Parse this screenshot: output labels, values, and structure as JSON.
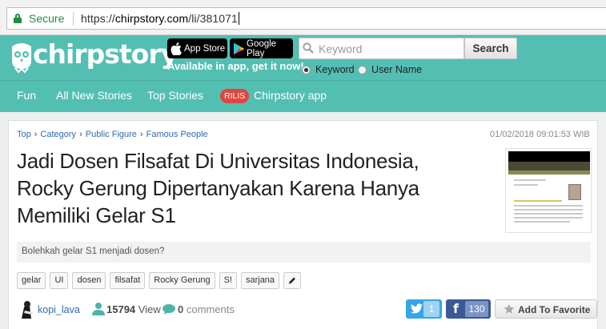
{
  "browser": {
    "secure_label": "Secure",
    "url_scheme": "https://",
    "url_host": "chirpstory.com",
    "url_path": "/li/381071"
  },
  "header": {
    "logo_text": "chirpstory",
    "app_store_label": "App Store",
    "google_play_label": "Google Play",
    "available_text": "Available in app, get it now!",
    "search": {
      "placeholder": "Keyword",
      "button_label": "Search",
      "options": [
        {
          "label": "Keyword",
          "selected": true
        },
        {
          "label": "User Name",
          "selected": false
        }
      ]
    }
  },
  "nav": {
    "items": [
      {
        "label": "Fun"
      },
      {
        "label": "All New Stories"
      },
      {
        "label": "Top Stories"
      }
    ],
    "badge": "RILIS",
    "app_label": "Chirpstory app"
  },
  "story": {
    "breadcrumbs": [
      "Top",
      "Category",
      "Public Figure",
      "Famous People"
    ],
    "date": "01/02/2018 09:01:53 WIB",
    "title": "Jadi Dosen Filsafat Di Universitas Indonesia, Rocky Gerung Dipertanyakan Karena Hanya Memiliki Gelar S1",
    "summary": "Bolehkah gelar S1 menjadi dosen?",
    "tags": [
      "gelar",
      "UI",
      "dosen",
      "filsafat",
      "Rocky Gerung",
      "S!",
      "sarjana"
    ],
    "author": "kopi_lava",
    "views_count": "15794",
    "views_label": "View",
    "comments_count": "0",
    "comments_label": "comments",
    "twitter_count": "1",
    "facebook_count": "130",
    "favorite_label": "Add To Favorite"
  },
  "colors": {
    "brand_teal": "#53bfb3",
    "badge_red": "#e0453f",
    "link_blue": "#2e6bb0",
    "twitter_blue": "#36a5e6",
    "facebook_blue": "#3b5998"
  },
  "icons": [
    "lock-icon",
    "apple-icon",
    "google-play-icon",
    "search-icon",
    "user-icon",
    "comment-icon",
    "twitter-icon",
    "facebook-icon",
    "star-icon",
    "pencil-icon"
  ]
}
